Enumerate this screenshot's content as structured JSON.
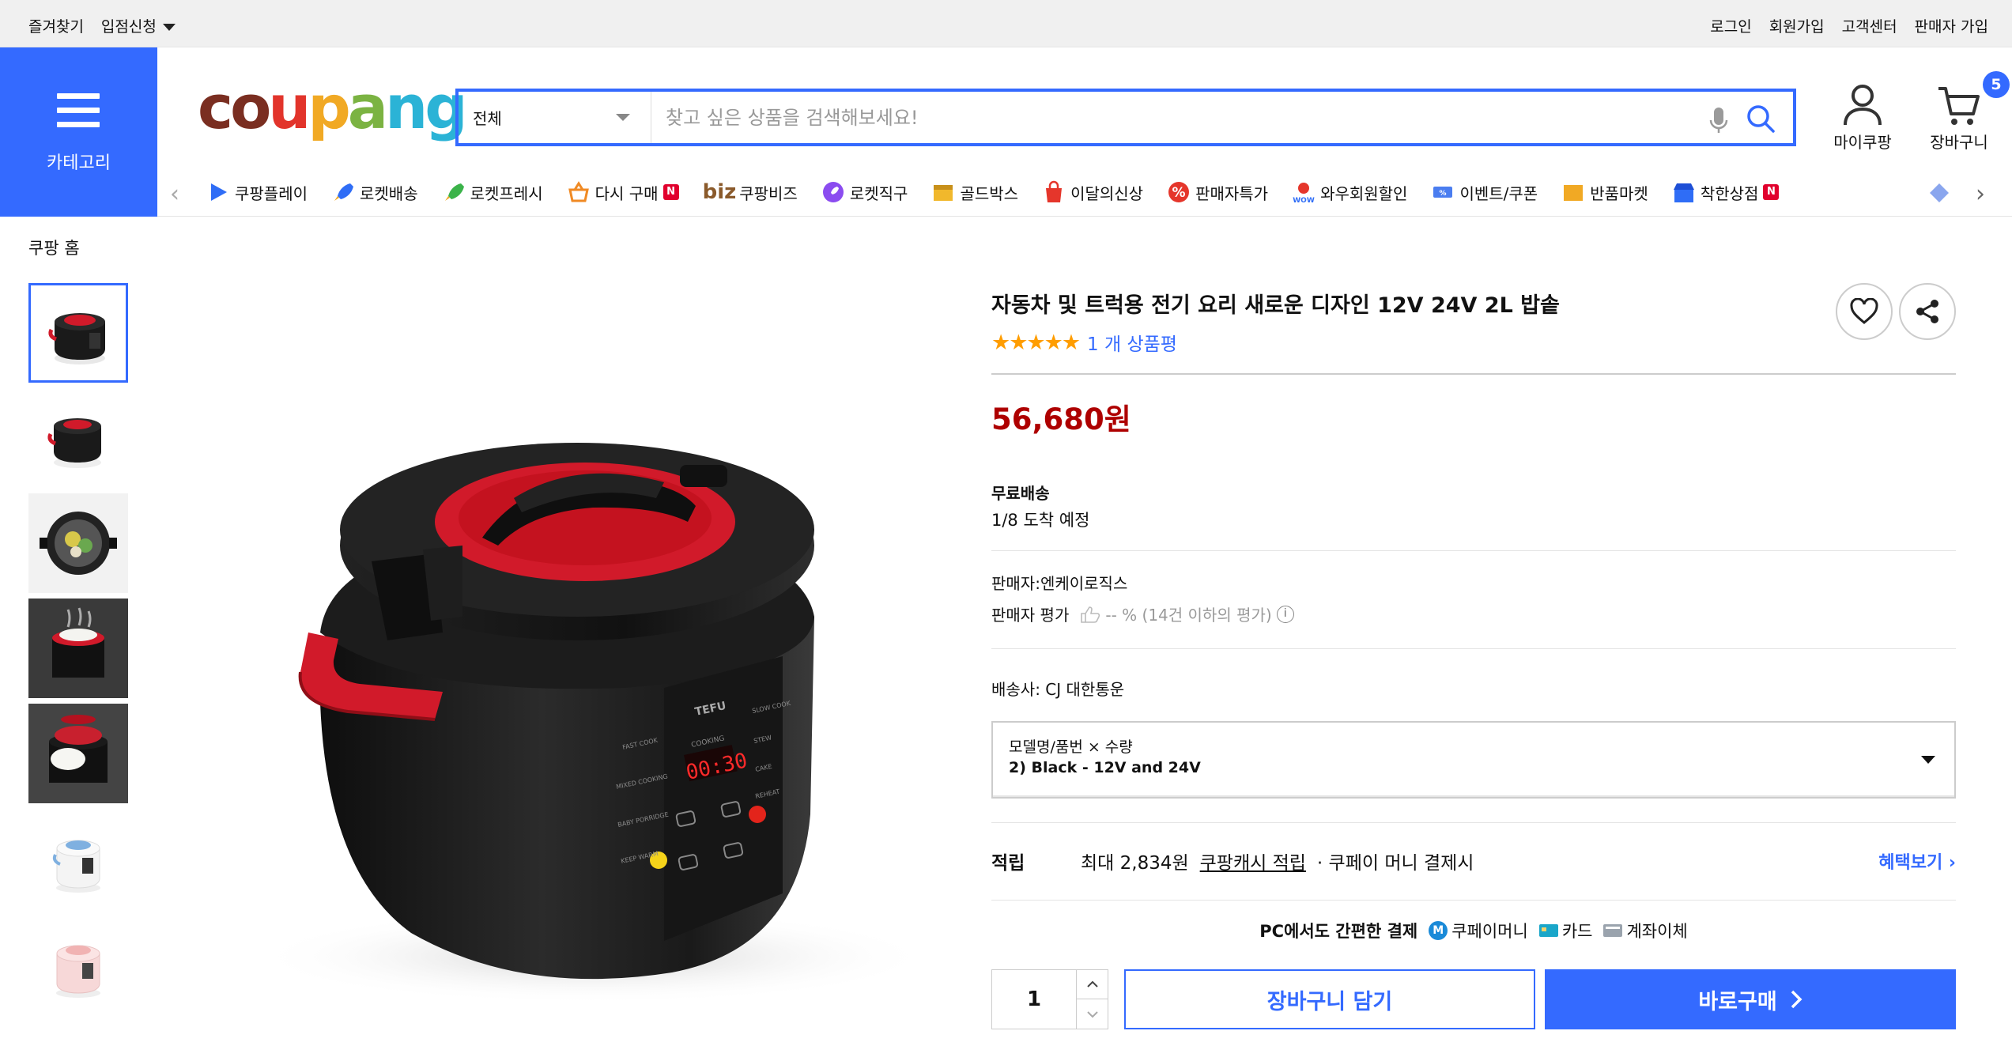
{
  "topbar": {
    "favorites": "즐겨찾기",
    "apply": "입점신청",
    "login": "로그인",
    "signup": "회원가입",
    "support": "고객센터",
    "seller_signup": "판매자 가입"
  },
  "category_button": "카테고리",
  "logo": [
    "c",
    "o",
    "u",
    "p",
    "a",
    "n",
    "g"
  ],
  "search": {
    "category": "전체",
    "placeholder": "찾고 싶은 상품을 검색해보세요!"
  },
  "header": {
    "mycoupang": "마이쿠팡",
    "cart": "장바구니",
    "cart_count": "5"
  },
  "nav": [
    {
      "label": "쿠팡플레이",
      "icon": "play-icon",
      "color": "#2f6df6"
    },
    {
      "label": "로켓배송",
      "icon": "rocket-icon",
      "color": "#2f6df6"
    },
    {
      "label": "로켓프레시",
      "icon": "rocket-fresh-icon",
      "color": "#3bb34a"
    },
    {
      "label": "다시 구매",
      "icon": "basket-icon",
      "color": "#f08a24",
      "badge": "N"
    },
    {
      "label": "쿠팡비즈",
      "icon": "biz-icon",
      "color": "#8a5a2b",
      "prefix": "biz"
    },
    {
      "label": "로켓직구",
      "icon": "rocket-global-icon",
      "color": "#8b4cf0"
    },
    {
      "label": "골드박스",
      "icon": "goldbox-icon",
      "color": "#f1b82c"
    },
    {
      "label": "이달의신상",
      "icon": "new-bag-icon",
      "color": "#e5362b"
    },
    {
      "label": "판매자특가",
      "icon": "percent-icon",
      "color": "#e5362b"
    },
    {
      "label": "와우회원할인",
      "icon": "wow-icon",
      "color": "#e5362b"
    },
    {
      "label": "이벤트/쿠폰",
      "icon": "coupon-icon",
      "color": "#4a7df0"
    },
    {
      "label": "반품마켓",
      "icon": "return-market-icon",
      "color": "#f1a924"
    },
    {
      "label": "착한상점",
      "icon": "store-icon",
      "color": "#2f6df6",
      "badge": "N"
    }
  ],
  "breadcrumb": "쿠팡 홈",
  "product": {
    "title": "자동차 및 트럭용 전기 요리 새로운 디자인 12V 24V 2L 밥솥",
    "stars": "★★★★★",
    "rating_value": 5,
    "review_count": "1 개 상품평",
    "price": "56,680원",
    "shipping_label": "무료배송",
    "delivery": "1/8 도착 예정",
    "seller": "판매자:엔케이로직스",
    "seller_rating_label": "판매자 평가",
    "seller_rating_value": "-- % (14건 이하의 평가)",
    "carrier": "배송사:  CJ 대한통운",
    "option_label": "모델명/품번 × 수량",
    "option_value": "2) Black - 12V and 24V",
    "reward_label": "적립",
    "reward_amount": "최대 2,834원",
    "reward_cash": "쿠팡캐시 적립",
    "reward_suffix": "· 쿠페이 머니 결제시",
    "benefit_link": "혜택보기",
    "pay_header": "PC에서도 간편한 결제",
    "pay_money": "쿠페이머니",
    "pay_card": "카드",
    "pay_bank": "계좌이체",
    "quantity": "1",
    "add_to_cart": "장바구니 담기",
    "buy_now": "바로구매"
  },
  "device_display": {
    "brand": "TEFU",
    "time": "00:30",
    "cooking": "COOKING",
    "left_modes": [
      "FAST COOK",
      "MIXED COOKING",
      "BABY PORRIDGE",
      "KEEP WARM"
    ],
    "right_modes": [
      "SLOW COOK",
      "STEW",
      "CAKE",
      "REHEAT"
    ]
  },
  "colors": {
    "accent": "#346aff",
    "price": "#ae0000",
    "star": "#ff9d00",
    "cooker_red": "#d11a2a"
  }
}
